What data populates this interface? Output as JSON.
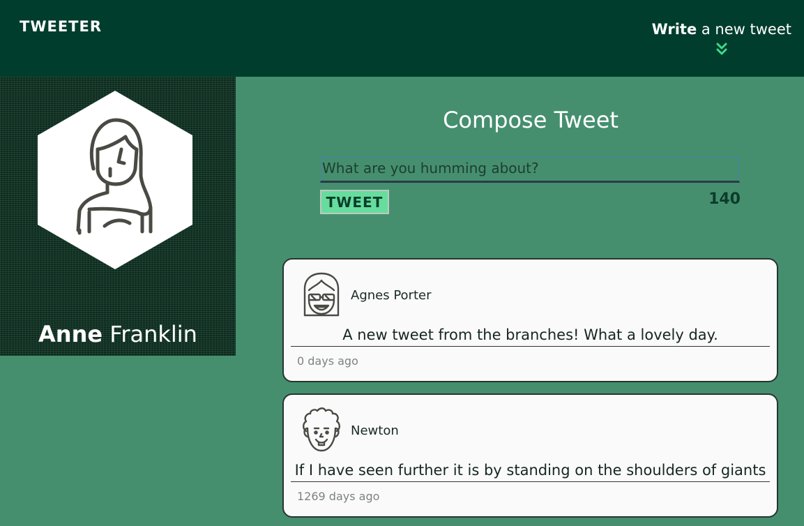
{
  "nav": {
    "brand": "TWEETER",
    "write_bold": "Write",
    "write_rest": " a new tweet",
    "chevron_icon": "double-chevron-down-icon",
    "accent": "#3fd98a"
  },
  "profile": {
    "first_name": "Anne",
    "last_name": " Franklin",
    "avatar_icon": "woman-avatar-icon"
  },
  "compose": {
    "title": "Compose Tweet",
    "placeholder": "What are you humming about?",
    "button_label": "TWEET",
    "counter": "140"
  },
  "tweets": [
    {
      "name": "Agnes Porter",
      "avatar_icon": "girl-glasses-avatar-icon",
      "content": "A new tweet from the branches! What a lovely day.",
      "time": "0 days ago"
    },
    {
      "name": "Newton",
      "avatar_icon": "curly-hair-avatar-icon",
      "content": "If I have seen further it is by standing on the shoulders of giants",
      "time": "1269 days ago"
    }
  ]
}
